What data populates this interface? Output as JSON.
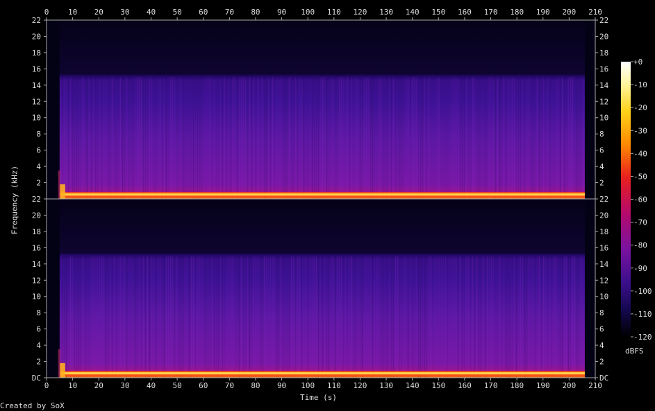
{
  "chart_data": {
    "type": "heatmap",
    "subtype": "spectrogram",
    "channels": 2,
    "xlabel": "Time (s)",
    "ylabel": "Frequency (kHz)",
    "x_ticks": [
      0,
      10,
      20,
      30,
      40,
      50,
      60,
      70,
      80,
      90,
      100,
      110,
      120,
      130,
      140,
      150,
      160,
      170,
      180,
      190,
      200,
      210
    ],
    "xlim": [
      0,
      210
    ],
    "y_tick_labels": [
      "DC",
      "2",
      "4",
      "6",
      "8",
      "10",
      "12",
      "14",
      "16",
      "18",
      "20",
      "22"
    ],
    "y_ticks_khz": [
      0,
      2,
      4,
      6,
      8,
      10,
      12,
      14,
      16,
      18,
      20,
      22
    ],
    "ylim_khz": [
      0,
      22
    ],
    "colorbar": {
      "label": "dBFS",
      "range_dbfs": [
        -120,
        0
      ],
      "tick_labels": [
        "+0",
        "-10",
        "-20",
        "-30",
        "-40",
        "-50",
        "-60",
        "-70",
        "-80",
        "-90",
        "-100",
        "-110",
        "-120"
      ],
      "tick_values": [
        0,
        -10,
        -20,
        -30,
        -40,
        -50,
        -60,
        -70,
        -80,
        -90,
        -100,
        -110,
        -120
      ]
    },
    "signal": {
      "start_s": 5,
      "end_s": 206,
      "bandwidth_khz": 15,
      "low_freq_peak_khz": 0.5
    },
    "footer": "Created by SoX"
  }
}
